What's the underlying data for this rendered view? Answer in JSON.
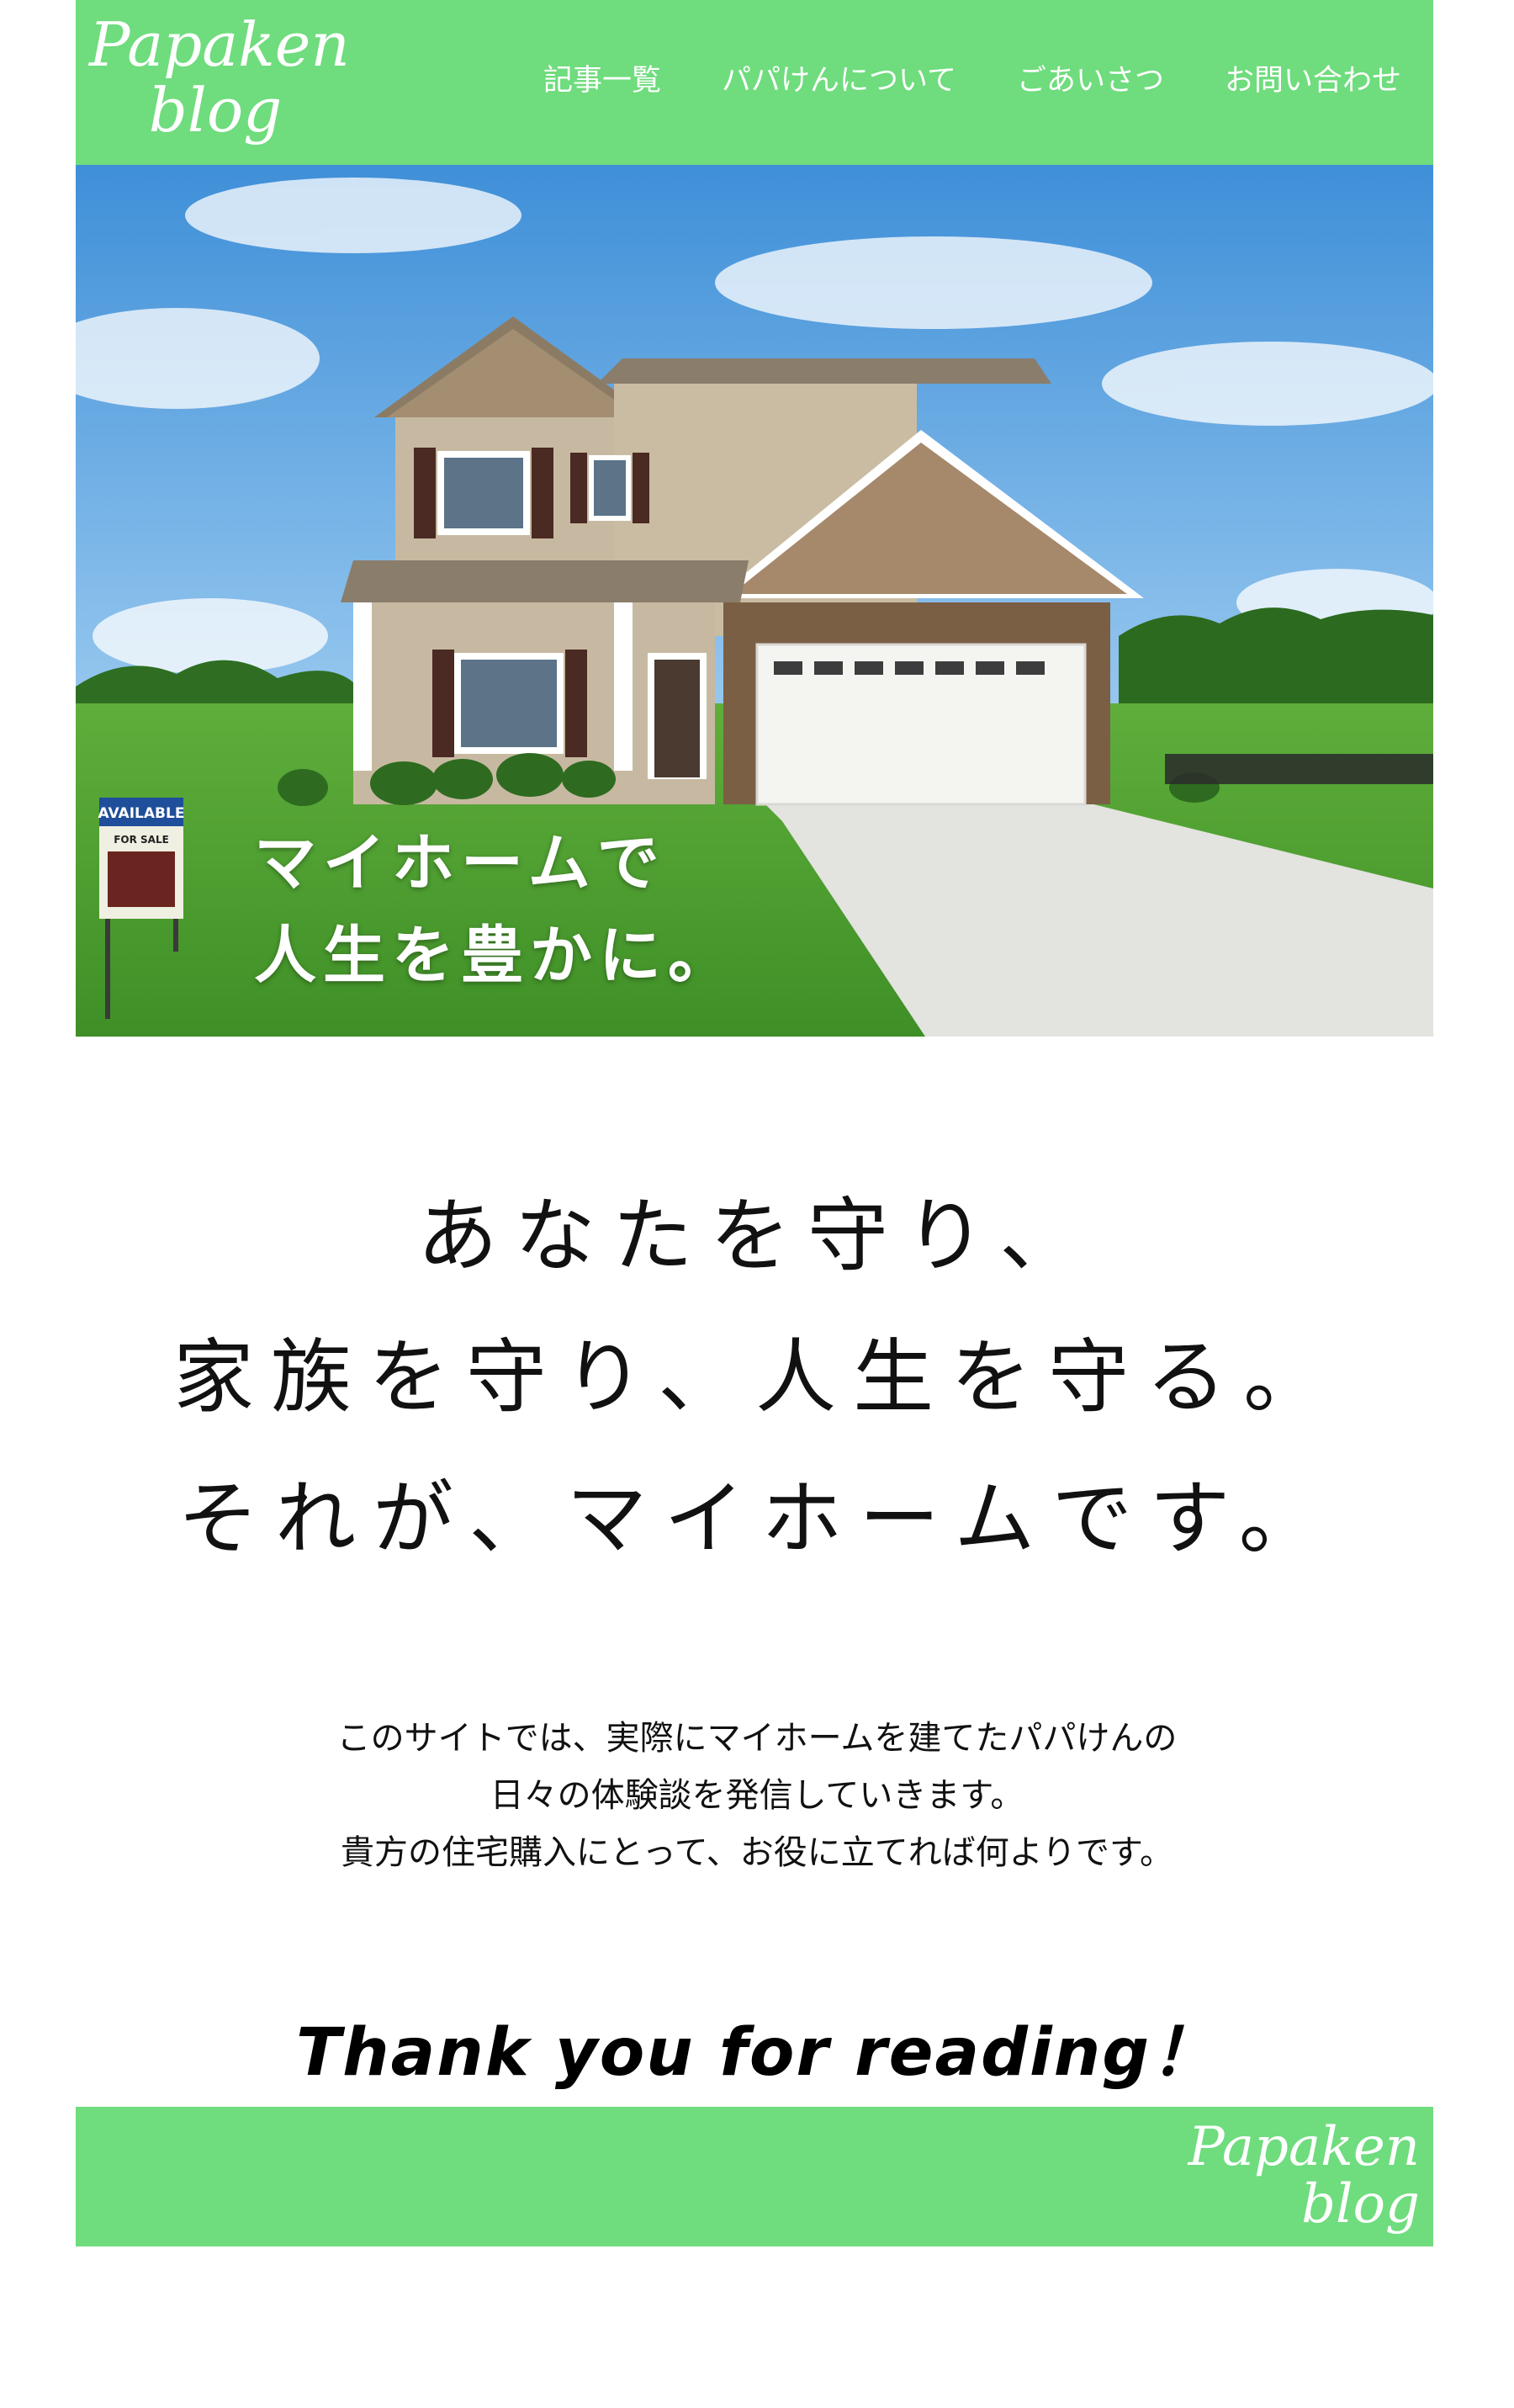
{
  "site": {
    "logo_line1": "Papaken",
    "logo_line2": "blog"
  },
  "nav": {
    "items": [
      "記事一覧",
      "パパけんについて",
      "ごあいさつ",
      "お問い合わせ"
    ]
  },
  "hero": {
    "line1": "マイホームで",
    "line2": "人生を豊かに。",
    "sign_text1": "AVAILABLE",
    "sign_text2": "FOR SALE"
  },
  "tagline": {
    "line1": "あなたを守り、",
    "line2": "家族を守り、人生を守る。",
    "line3": "それが、マイホームです。"
  },
  "intro": {
    "line1": "このサイトでは、実際にマイホームを建てたパパけんの",
    "line2": "日々の体験談を発信していきます。",
    "line3": "貴方の住宅購入にとって、お役に立てれば何よりです。"
  },
  "closing": "Thank you for reading！",
  "footer": {
    "logo_line1": "Papaken",
    "logo_line2": "blog"
  },
  "colors": {
    "brand_green": "#6fdc7d"
  }
}
